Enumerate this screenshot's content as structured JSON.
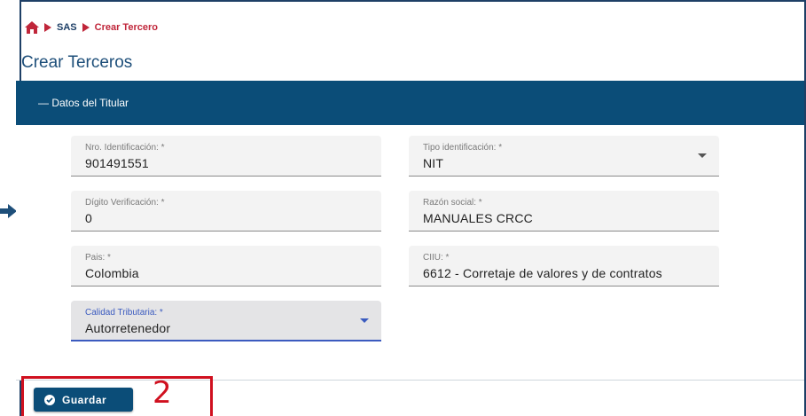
{
  "breadcrumb": {
    "items": [
      "SAS"
    ],
    "active": "Crear Tercero"
  },
  "page_title": "Crear Terceros",
  "section": {
    "header": "— Datos del Titular"
  },
  "fields": {
    "nro_identificacion": {
      "label": "Nro. Identificación: *",
      "value": "901491551"
    },
    "tipo_identificacion": {
      "label": "Tipo identificación: *",
      "value": "NIT"
    },
    "digito_verificacion": {
      "label": "Dígito Verificación: *",
      "value": "0"
    },
    "razon_social": {
      "label": "Razón social: *",
      "value": "MANUALES CRCC"
    },
    "pais": {
      "label": "Pais: *",
      "value": "Colombia"
    },
    "ciiu": {
      "label": "CIIU: *",
      "value": "6612 - Corretaje de valores y de contratos"
    },
    "calidad_tributaria": {
      "label": "Calidad Tributaria: *",
      "value": "Autorretenedor"
    }
  },
  "actions": {
    "save_label": "Guardar"
  },
  "annotation": {
    "step": "2"
  },
  "colors": {
    "primary": "#0b4d78",
    "accent": "#c0263a",
    "annotation": "#d0101f",
    "focus": "#3b5bbf"
  }
}
